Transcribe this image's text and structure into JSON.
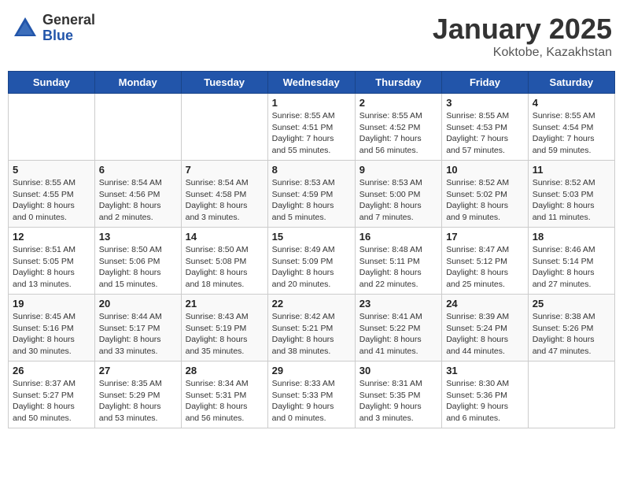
{
  "header": {
    "logo_general": "General",
    "logo_blue": "Blue",
    "month": "January 2025",
    "location": "Koktobe, Kazakhstan"
  },
  "weekdays": [
    "Sunday",
    "Monday",
    "Tuesday",
    "Wednesday",
    "Thursday",
    "Friday",
    "Saturday"
  ],
  "weeks": [
    [
      {
        "day": "",
        "info": ""
      },
      {
        "day": "",
        "info": ""
      },
      {
        "day": "",
        "info": ""
      },
      {
        "day": "1",
        "info": "Sunrise: 8:55 AM\nSunset: 4:51 PM\nDaylight: 7 hours\nand 55 minutes."
      },
      {
        "day": "2",
        "info": "Sunrise: 8:55 AM\nSunset: 4:52 PM\nDaylight: 7 hours\nand 56 minutes."
      },
      {
        "day": "3",
        "info": "Sunrise: 8:55 AM\nSunset: 4:53 PM\nDaylight: 7 hours\nand 57 minutes."
      },
      {
        "day": "4",
        "info": "Sunrise: 8:55 AM\nSunset: 4:54 PM\nDaylight: 7 hours\nand 59 minutes."
      }
    ],
    [
      {
        "day": "5",
        "info": "Sunrise: 8:55 AM\nSunset: 4:55 PM\nDaylight: 8 hours\nand 0 minutes."
      },
      {
        "day": "6",
        "info": "Sunrise: 8:54 AM\nSunset: 4:56 PM\nDaylight: 8 hours\nand 2 minutes."
      },
      {
        "day": "7",
        "info": "Sunrise: 8:54 AM\nSunset: 4:58 PM\nDaylight: 8 hours\nand 3 minutes."
      },
      {
        "day": "8",
        "info": "Sunrise: 8:53 AM\nSunset: 4:59 PM\nDaylight: 8 hours\nand 5 minutes."
      },
      {
        "day": "9",
        "info": "Sunrise: 8:53 AM\nSunset: 5:00 PM\nDaylight: 8 hours\nand 7 minutes."
      },
      {
        "day": "10",
        "info": "Sunrise: 8:52 AM\nSunset: 5:02 PM\nDaylight: 8 hours\nand 9 minutes."
      },
      {
        "day": "11",
        "info": "Sunrise: 8:52 AM\nSunset: 5:03 PM\nDaylight: 8 hours\nand 11 minutes."
      }
    ],
    [
      {
        "day": "12",
        "info": "Sunrise: 8:51 AM\nSunset: 5:05 PM\nDaylight: 8 hours\nand 13 minutes."
      },
      {
        "day": "13",
        "info": "Sunrise: 8:50 AM\nSunset: 5:06 PM\nDaylight: 8 hours\nand 15 minutes."
      },
      {
        "day": "14",
        "info": "Sunrise: 8:50 AM\nSunset: 5:08 PM\nDaylight: 8 hours\nand 18 minutes."
      },
      {
        "day": "15",
        "info": "Sunrise: 8:49 AM\nSunset: 5:09 PM\nDaylight: 8 hours\nand 20 minutes."
      },
      {
        "day": "16",
        "info": "Sunrise: 8:48 AM\nSunset: 5:11 PM\nDaylight: 8 hours\nand 22 minutes."
      },
      {
        "day": "17",
        "info": "Sunrise: 8:47 AM\nSunset: 5:12 PM\nDaylight: 8 hours\nand 25 minutes."
      },
      {
        "day": "18",
        "info": "Sunrise: 8:46 AM\nSunset: 5:14 PM\nDaylight: 8 hours\nand 27 minutes."
      }
    ],
    [
      {
        "day": "19",
        "info": "Sunrise: 8:45 AM\nSunset: 5:16 PM\nDaylight: 8 hours\nand 30 minutes."
      },
      {
        "day": "20",
        "info": "Sunrise: 8:44 AM\nSunset: 5:17 PM\nDaylight: 8 hours\nand 33 minutes."
      },
      {
        "day": "21",
        "info": "Sunrise: 8:43 AM\nSunset: 5:19 PM\nDaylight: 8 hours\nand 35 minutes."
      },
      {
        "day": "22",
        "info": "Sunrise: 8:42 AM\nSunset: 5:21 PM\nDaylight: 8 hours\nand 38 minutes."
      },
      {
        "day": "23",
        "info": "Sunrise: 8:41 AM\nSunset: 5:22 PM\nDaylight: 8 hours\nand 41 minutes."
      },
      {
        "day": "24",
        "info": "Sunrise: 8:39 AM\nSunset: 5:24 PM\nDaylight: 8 hours\nand 44 minutes."
      },
      {
        "day": "25",
        "info": "Sunrise: 8:38 AM\nSunset: 5:26 PM\nDaylight: 8 hours\nand 47 minutes."
      }
    ],
    [
      {
        "day": "26",
        "info": "Sunrise: 8:37 AM\nSunset: 5:27 PM\nDaylight: 8 hours\nand 50 minutes."
      },
      {
        "day": "27",
        "info": "Sunrise: 8:35 AM\nSunset: 5:29 PM\nDaylight: 8 hours\nand 53 minutes."
      },
      {
        "day": "28",
        "info": "Sunrise: 8:34 AM\nSunset: 5:31 PM\nDaylight: 8 hours\nand 56 minutes."
      },
      {
        "day": "29",
        "info": "Sunrise: 8:33 AM\nSunset: 5:33 PM\nDaylight: 9 hours\nand 0 minutes."
      },
      {
        "day": "30",
        "info": "Sunrise: 8:31 AM\nSunset: 5:35 PM\nDaylight: 9 hours\nand 3 minutes."
      },
      {
        "day": "31",
        "info": "Sunrise: 8:30 AM\nSunset: 5:36 PM\nDaylight: 9 hours\nand 6 minutes."
      },
      {
        "day": "",
        "info": ""
      }
    ]
  ]
}
